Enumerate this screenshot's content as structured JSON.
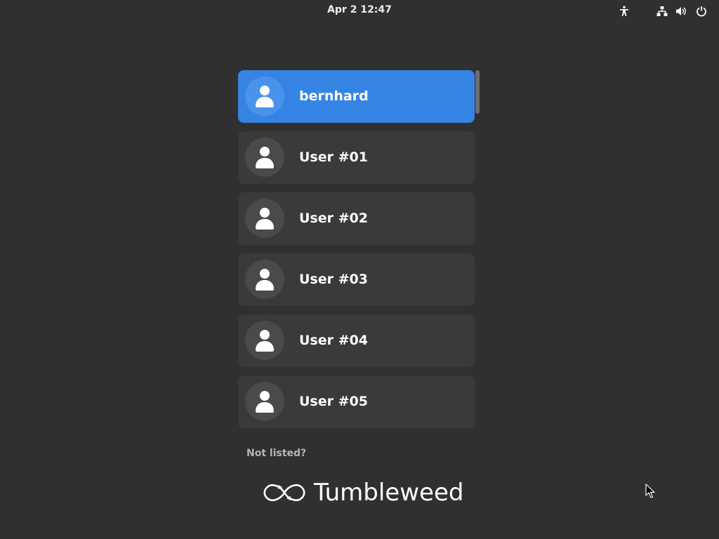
{
  "topbar": {
    "clock": "Apr 2  12:47",
    "icons": [
      "accessibility-icon",
      "network-icon",
      "volume-icon",
      "power-icon"
    ]
  },
  "users": [
    {
      "name": "bernhard",
      "selected": true
    },
    {
      "name": "User #01",
      "selected": false
    },
    {
      "name": "User #02",
      "selected": false
    },
    {
      "name": "User #03",
      "selected": false
    },
    {
      "name": "User #04",
      "selected": false
    },
    {
      "name": "User #05",
      "selected": false
    }
  ],
  "not_listed": "Not listed?",
  "brand": {
    "logo": "infinity-arrows-icon",
    "name": "Tumbleweed"
  },
  "colors": {
    "background": "#303030",
    "row": "#3a3a3a",
    "selected_row": "#3584e4",
    "muted_text": "#b5b5b5"
  }
}
